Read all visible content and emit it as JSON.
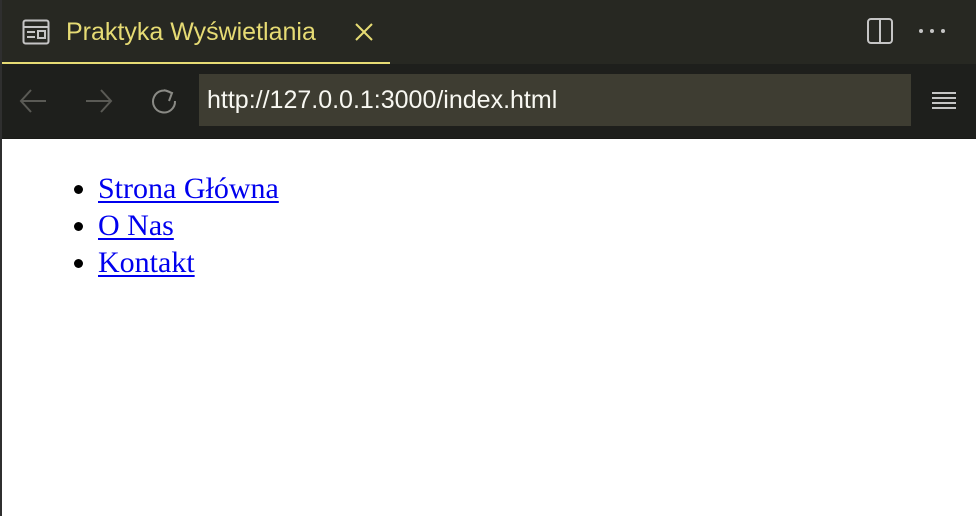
{
  "tab": {
    "title": "Praktyka Wyświetlania",
    "icon": "preview-icon",
    "close_icon": "close-icon"
  },
  "toolbar": {
    "split_icon": "split-editor-icon",
    "more_icon": "more-actions-icon"
  },
  "navigation": {
    "back_icon": "arrow-left-icon",
    "forward_icon": "arrow-right-icon",
    "reload_icon": "reload-icon",
    "url": "http://127.0.0.1:3000/index.html",
    "menu_icon": "hamburger-menu-icon"
  },
  "page": {
    "links": [
      {
        "label": "Strona Główna"
      },
      {
        "label": "O Nas"
      },
      {
        "label": "Kontakt"
      }
    ]
  },
  "colors": {
    "tab_accent": "#e6db74",
    "tabbar_bg": "#272822",
    "navbar_bg": "#1e1f1c",
    "url_bg": "#3e3d32",
    "url_text": "#f8f8f2",
    "link": "#0000ee"
  }
}
